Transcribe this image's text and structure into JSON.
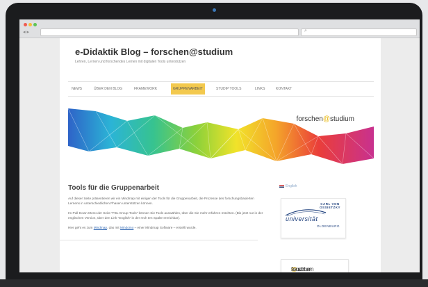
{
  "blog": {
    "title": "e-Didaktik Blog – forschen@studium",
    "description": "Lehren, Lernen und forschendes Lernen mit digitalen Tools unterstützen"
  },
  "nav": {
    "items": [
      {
        "label": "News"
      },
      {
        "label": "Über den Blog"
      },
      {
        "label": "Framework"
      },
      {
        "label": "Gruppenarbeit",
        "active": true
      },
      {
        "label": "Studip Tools"
      },
      {
        "label": "Links"
      },
      {
        "label": "Kontakt"
      }
    ]
  },
  "banner": {
    "logo_prefix": "forschen",
    "logo_at": "@",
    "logo_suffix": "studium"
  },
  "post": {
    "title": "Tools für die Gruppenarbeit",
    "paragraph1": "Auf dieser Seite präsentieren wir ein Mindmap mit einigen der Tools für die Gruppenarbeit, die Prozesse des forschungsbasierten Lernens in unterschiedlichen Phasen unterstützen können.",
    "paragraph2": "Im Pull-Down Menü der Seite “FBL Group Tools” können Sie Tools auswählen, über die Sie mehr erfahren möchten. (Bis jetzt nur in der englischen Version, über den Link “English” in der rech ten Spalte erreichbar).",
    "paragraph3_before": "Hier geht es zum ",
    "paragraph3_link1": "Mindmap",
    "paragraph3_middle": ", das mit ",
    "paragraph3_link2": "Mindomo",
    "paragraph3_after": " – einer Mindmap Software – erstellt wurde."
  },
  "sidebar": {
    "language_link": "English",
    "uni_logo": {
      "founder": "CARL VON OSSIETZKY",
      "name": "universität",
      "city": "OLDENBURG"
    },
    "project_logo": {
      "prefix": "forschen",
      "at": "@",
      "suffix": "studium"
    }
  },
  "colors": {
    "active_nav": "#f3c94e",
    "link": "#3b6fb6",
    "university_blue": "#1d3f7c",
    "logo_at": "#e8b400"
  }
}
